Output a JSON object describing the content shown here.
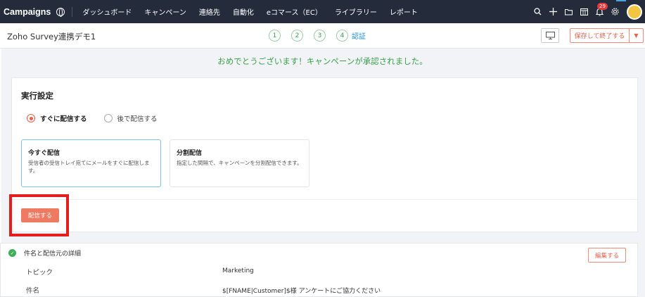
{
  "nav": {
    "brand": "Campaigns",
    "items": [
      "ダッシュボード",
      "キャンペーン",
      "連絡先",
      "自動化",
      "eコマース（EC）",
      "ライブラリー",
      "レポート"
    ],
    "notification_count": "29",
    "icons": [
      "search-icon",
      "plus-icon",
      "folder-icon",
      "calendar-icon",
      "bell-icon",
      "gear-icon"
    ]
  },
  "header": {
    "title": "Zoho Survey連携デモ1",
    "steps": [
      "1",
      "2",
      "3",
      "4"
    ],
    "current_step_label": "認証",
    "save_label": "保存して終了する",
    "dropdown_glyph": "▼"
  },
  "banner": {
    "message": "おめでとうございます！キャンペーンが承認されました。"
  },
  "run_settings": {
    "title": "実行設定",
    "radio_now": "すぐに配信する",
    "radio_later": "後で配信する",
    "options": [
      {
        "title": "今すぐ配信",
        "desc": "受信者の受信トレイ宛てにメールをすぐに配信します。"
      },
      {
        "title": "分割配信",
        "desc": "指定した間隔で、キャンペーンを分割配信できます。"
      }
    ],
    "send_label": "配信する"
  },
  "details": {
    "title": "件名と配信元の詳細",
    "edit_label": "編集する",
    "rows": [
      {
        "label": "トピック",
        "value": "Marketing"
      },
      {
        "label": "件名",
        "value": "$[FNAME|Customer]$様 アンケートにご協力ください"
      }
    ]
  },
  "colors": {
    "nav_bg": "#242c3c",
    "accent": "#ef7a62",
    "success": "#3aa04b",
    "highlight": "#e41e1e"
  }
}
